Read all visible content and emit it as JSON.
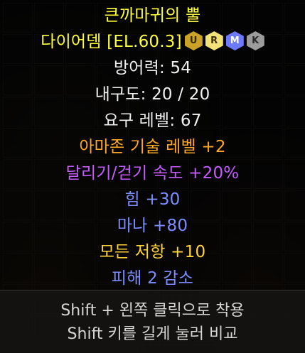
{
  "item": {
    "name": "큰까마귀의 뿔",
    "base": "다이어뎀 [EL.60.3]",
    "tiers": [
      {
        "letter": "U",
        "color": "#c9a227",
        "text_color": "#3a2b05"
      },
      {
        "letter": "R",
        "color": "#f2e27a",
        "text_color": "#3a3205"
      },
      {
        "letter": "M",
        "color": "#6d79ff",
        "text_color": "#ffffff"
      },
      {
        "letter": "K",
        "color": "#9c9c9c",
        "text_color": "#2a2a2a"
      }
    ],
    "stats": {
      "defense": "방어력: 54",
      "durability": "내구도: 20 / 20",
      "required_level": "요구 레벨: 67"
    },
    "mods": {
      "skill": "아마존 기술 레벨 +2",
      "run_speed": "달리기/걷기 속도 +20%",
      "strength": "힘 +30",
      "mana": "마나 +80",
      "resist": "모든 저항 +10",
      "damage_reduce": "피해 2 감소"
    }
  },
  "hints": {
    "equip": "Shift + 왼쪽 클릭으로 착용",
    "compare": "Shift 키를 길게 눌러 비교"
  },
  "colors": {
    "unique_name": "#ffff3a",
    "white_stat": "#f0f0f0",
    "class_skill": "#ffa726",
    "magic_purple": "#c45cff",
    "magic_blue": "#7b8dff",
    "set_gold": "#ffd23a"
  }
}
